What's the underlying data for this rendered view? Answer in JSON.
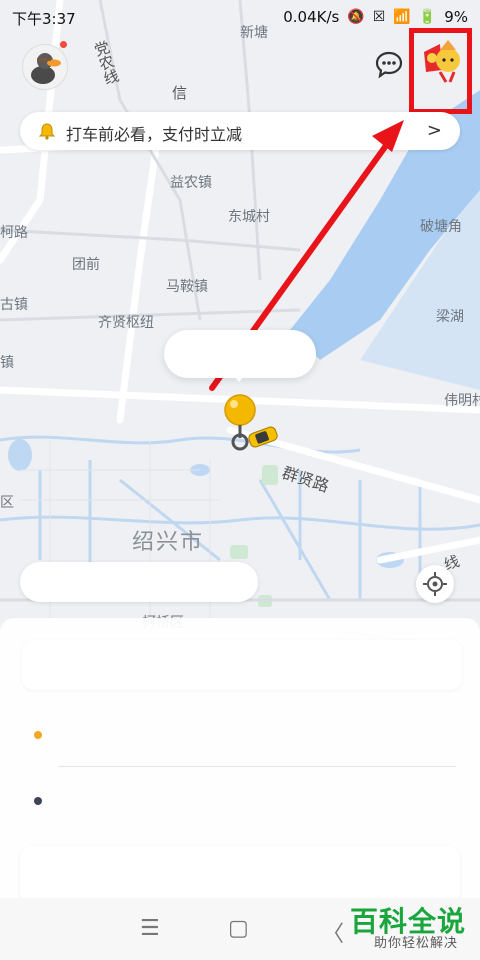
{
  "status_bar": {
    "time": "下午3:37",
    "network_speed": "0.04K/s",
    "battery": "9%"
  },
  "map": {
    "labels": {
      "xintang": "新塘",
      "dangnong_line": "党农线",
      "xin": "信",
      "yinong_town": "益农镇",
      "dongcheng_village": "东城村",
      "ke_road": "柯路",
      "tuanqian": "团前",
      "maan_town": "马鞍镇",
      "gu_town": "古镇",
      "qixian_hub": "齐贤枢纽",
      "town_left": "镇",
      "pojiao": "破塘角",
      "lianghu": "梁湖",
      "weiming": "伟明村",
      "qunxian_road": "群贤路",
      "shaoxing_city": "绍兴市",
      "ke_district": "柯桥区",
      "line_right": "线",
      "district_left": "区"
    }
  },
  "top_bar": {
    "notice_text": "打车前必看，支付时立减",
    "notice_chevron": ">"
  },
  "bottom_sheet": {
    "start_label": "",
    "end_label": ""
  },
  "nav_bar": {
    "menu_glyph": "☰",
    "home_glyph": "▢",
    "back_glyph": "〈"
  },
  "watermark": {
    "title": "百科全说",
    "subtitle": "助你轻松解决"
  },
  "colors": {
    "accent_yellow": "#f5b800",
    "highlight_red": "#e8141a",
    "arrow_red": "#e8141a",
    "watermark_green": "#1aa63d"
  },
  "icons": [
    "avatar-icon",
    "chat-icon",
    "promo-fu-icon",
    "bell-icon",
    "chevron-right-icon",
    "location-pin-icon",
    "car-icon",
    "locate-icon"
  ]
}
